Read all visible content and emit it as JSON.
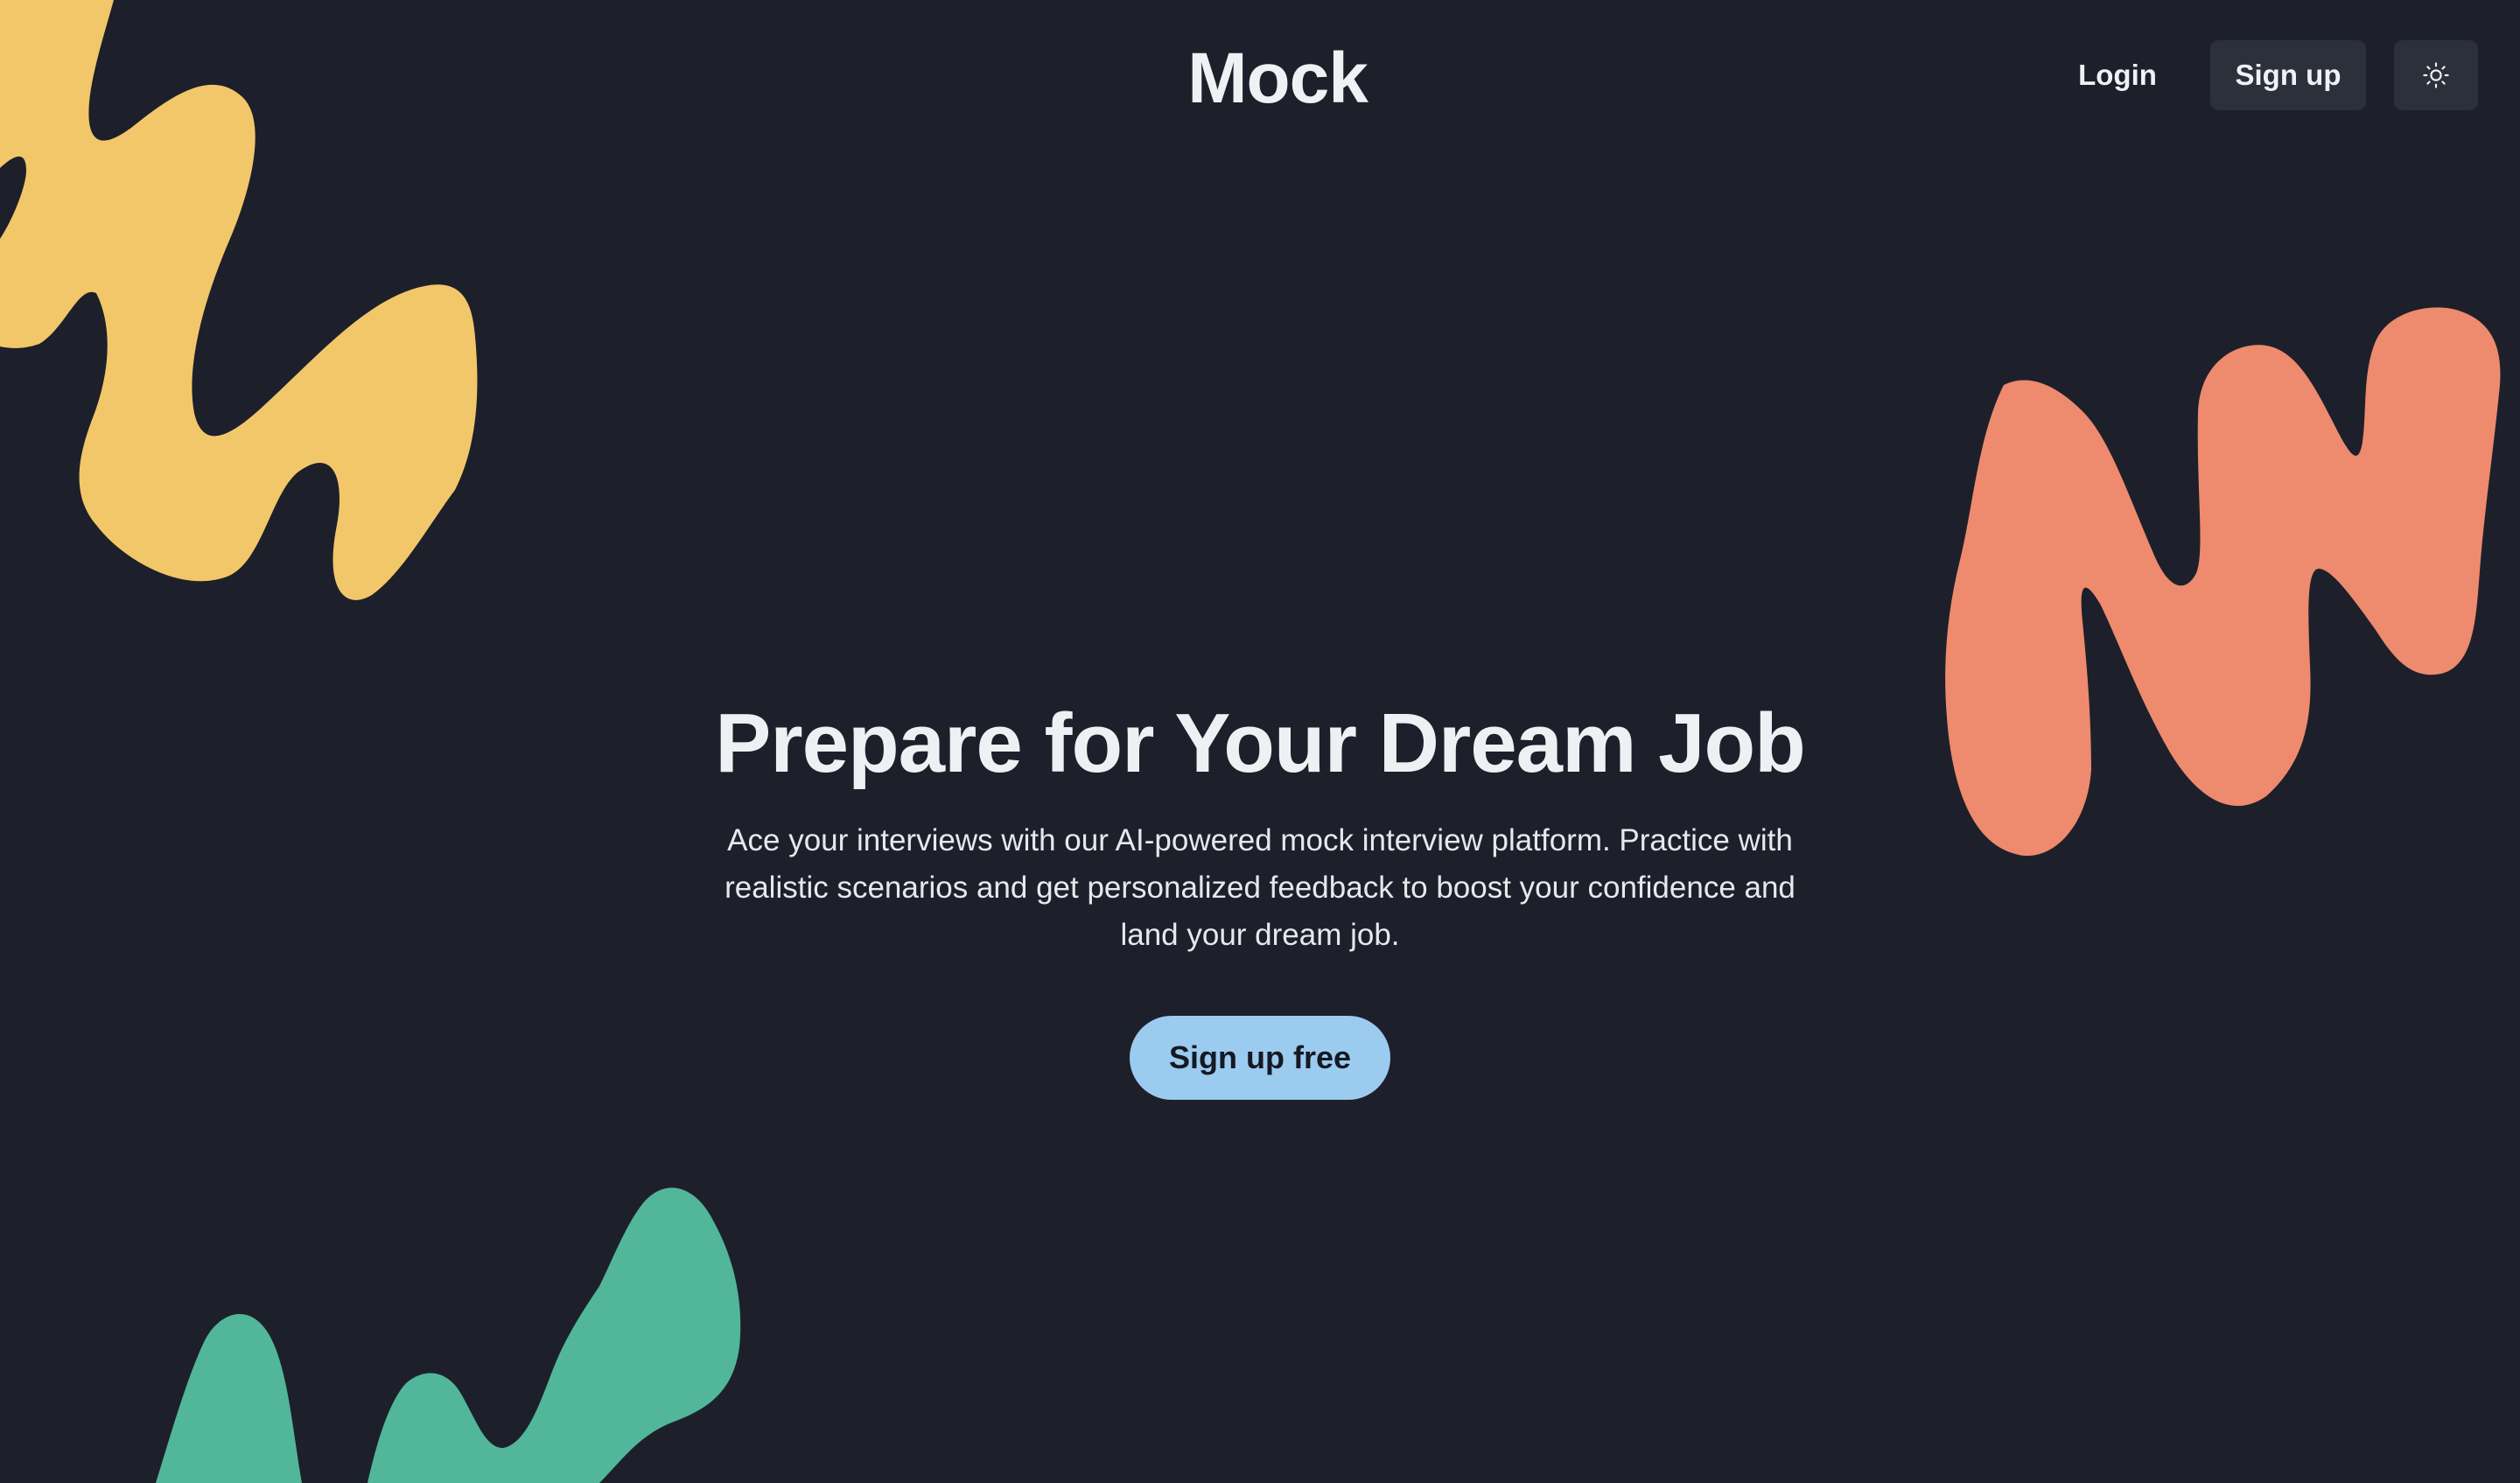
{
  "header": {
    "logo": "Mock",
    "login_label": "Login",
    "signup_label": "Sign up",
    "theme_icon": "sun-icon"
  },
  "hero": {
    "title": "Prepare for Your Dream Job",
    "description": "Ace your interviews with our AI-powered mock interview platform. Practice with realistic scenarios and get personalized feedback to boost your confidence and land your dream job.",
    "cta_label": "Sign up free"
  },
  "colors": {
    "background": "#1d202a",
    "button_bg": "#2c303b",
    "cta_bg": "#9ccbf0",
    "blob_yellow": "#f2c76a",
    "blob_coral": "#ee8a6e",
    "blob_green": "#52b69a"
  }
}
